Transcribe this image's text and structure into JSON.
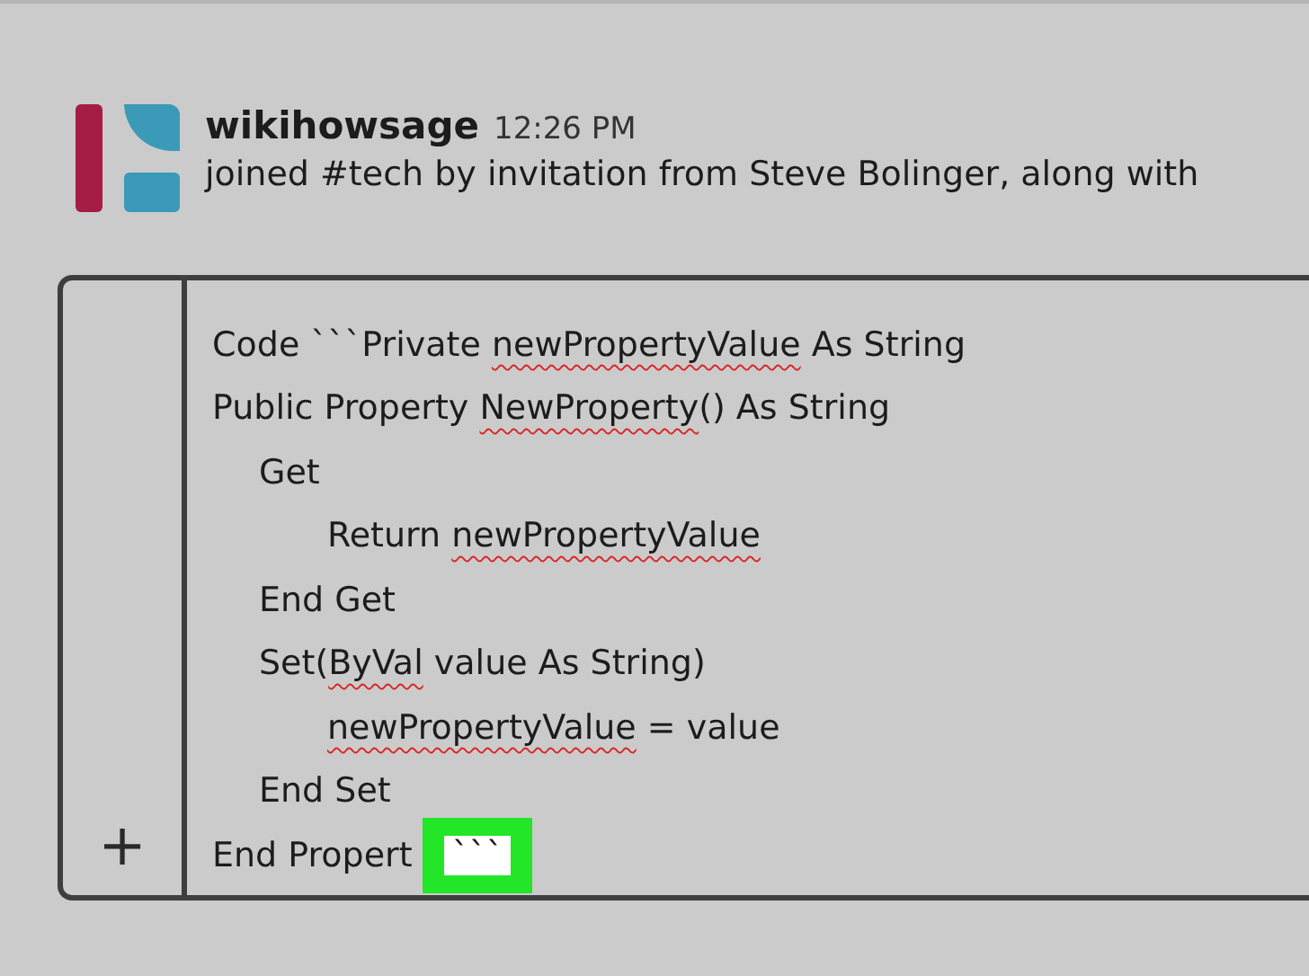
{
  "message": {
    "author": "wikihowsage",
    "time": "12:26 PM",
    "text": "joined #tech by invitation from Steve Bolinger, along with"
  },
  "composer": {
    "add_button": "+",
    "lines": [
      {
        "kind": "top",
        "segments": [
          {
            "text": "Code ```Private ",
            "misspelled": false
          },
          {
            "text": "newPropertyValue",
            "misspelled": true
          },
          {
            "text": " As String",
            "misspelled": false
          }
        ]
      },
      {
        "kind": "top",
        "segments": [
          {
            "text": "Public Property ",
            "misspelled": false
          },
          {
            "text": "NewProperty",
            "misspelled": true
          },
          {
            "text": "() As String",
            "misspelled": false
          }
        ]
      },
      {
        "kind": "block",
        "segments": [
          {
            "text": "Get",
            "misspelled": false
          }
        ]
      },
      {
        "kind": "statement",
        "segments": [
          {
            "text": "Return ",
            "misspelled": false
          },
          {
            "text": "newPropertyValue",
            "misspelled": true
          }
        ]
      },
      {
        "kind": "block",
        "segments": [
          {
            "text": "End Get",
            "misspelled": false
          }
        ]
      },
      {
        "kind": "block",
        "segments": [
          {
            "text": "Set(",
            "misspelled": false
          },
          {
            "text": "ByVal",
            "misspelled": true
          },
          {
            "text": " value As String)",
            "misspelled": false
          }
        ]
      },
      {
        "kind": "statement",
        "segments": [
          {
            "text": "newPropertyValue",
            "misspelled": true
          },
          {
            "text": " = value",
            "misspelled": false
          }
        ]
      },
      {
        "kind": "block",
        "segments": [
          {
            "text": "End Set",
            "misspelled": false
          }
        ]
      },
      {
        "kind": "top",
        "segments": [
          {
            "text": "End Propert",
            "misspelled": false
          }
        ]
      }
    ],
    "highlight": {
      "text": "```"
    }
  }
}
